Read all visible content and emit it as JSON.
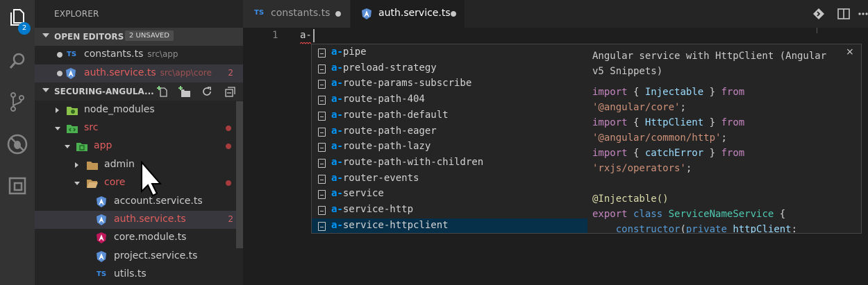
{
  "activity_bar": {
    "explorer_badge": "2",
    "items": [
      "files-icon",
      "search-icon",
      "source-control-icon",
      "debug-icon",
      "extensions-icon"
    ]
  },
  "sidebar": {
    "title": "EXPLORER",
    "open_editors": {
      "header": "OPEN EDITORS",
      "badge": "2 UNSAVED",
      "items": [
        {
          "name": "constants.ts",
          "path": "src\\app",
          "icon": "TS",
          "color": "#cccccc",
          "problems": ""
        },
        {
          "name": "auth.service.ts",
          "path": "src\\app\\core",
          "icon": "angular",
          "color": "#e25e5e",
          "problems": "2"
        }
      ]
    },
    "project": {
      "header": "SECURING-ANGULA...",
      "tree": [
        {
          "name": "node_modules",
          "type": "folder",
          "color": "#cccccc"
        },
        {
          "name": "src",
          "type": "folder",
          "color": "#e25e5e"
        },
        {
          "name": "app",
          "type": "folder",
          "color": "#e25e5e"
        },
        {
          "name": "admin",
          "type": "folder",
          "color": "#cccccc"
        },
        {
          "name": "core",
          "type": "folder",
          "color": "#e25e5e"
        },
        {
          "name": "account.service.ts",
          "type": "file",
          "color": "#cccccc"
        },
        {
          "name": "auth.service.ts",
          "type": "file",
          "color": "#e25e5e",
          "problems": "2"
        },
        {
          "name": "core.module.ts",
          "type": "file",
          "color": "#cccccc"
        },
        {
          "name": "project.service.ts",
          "type": "file",
          "color": "#cccccc"
        },
        {
          "name": "utils.ts",
          "type": "file",
          "color": "#cccccc"
        }
      ]
    }
  },
  "tabs": [
    {
      "label": "constants.ts",
      "icon": "TS",
      "active": false
    },
    {
      "label": "auth.service.ts",
      "icon": "angular",
      "active": true
    }
  ],
  "editor": {
    "line_number": "1",
    "code": "a-"
  },
  "suggest": {
    "prefix": "a-",
    "items": [
      "pipe",
      "preload-strategy",
      "route-params-subscribe",
      "route-path-404",
      "route-path-default",
      "route-path-eager",
      "route-path-lazy",
      "route-path-with-children",
      "router-events",
      "service",
      "service-http",
      "service-httpclient"
    ],
    "selected_index": 11
  },
  "details": {
    "title": "Angular service with HttpClient (Angular v5 Snippets)",
    "close": "×",
    "code": {
      "l1": {
        "kw": "import",
        "p1": " { ",
        "id": "Injectable",
        "p2": " } ",
        "from": "from"
      },
      "l2": "'@angular/core'",
      "l3": {
        "kw": "import",
        "p1": " { ",
        "id": "HttpClient",
        "p2": " } ",
        "from": "from"
      },
      "l4": "'@angular/common/http'",
      "l5": {
        "kw": "import",
        "p1": " { ",
        "id": "catchError",
        "p2": " } ",
        "from": "from"
      },
      "l6": "'rxjs/operators'",
      "l8": "@Injectable()",
      "l9": {
        "kw1": "export",
        "kw2": "class",
        "name": "ServiceNameService",
        "brace": "{"
      },
      "l10": {
        "fn": "constructor",
        "kw": "private",
        "id": "httpClient"
      }
    }
  }
}
